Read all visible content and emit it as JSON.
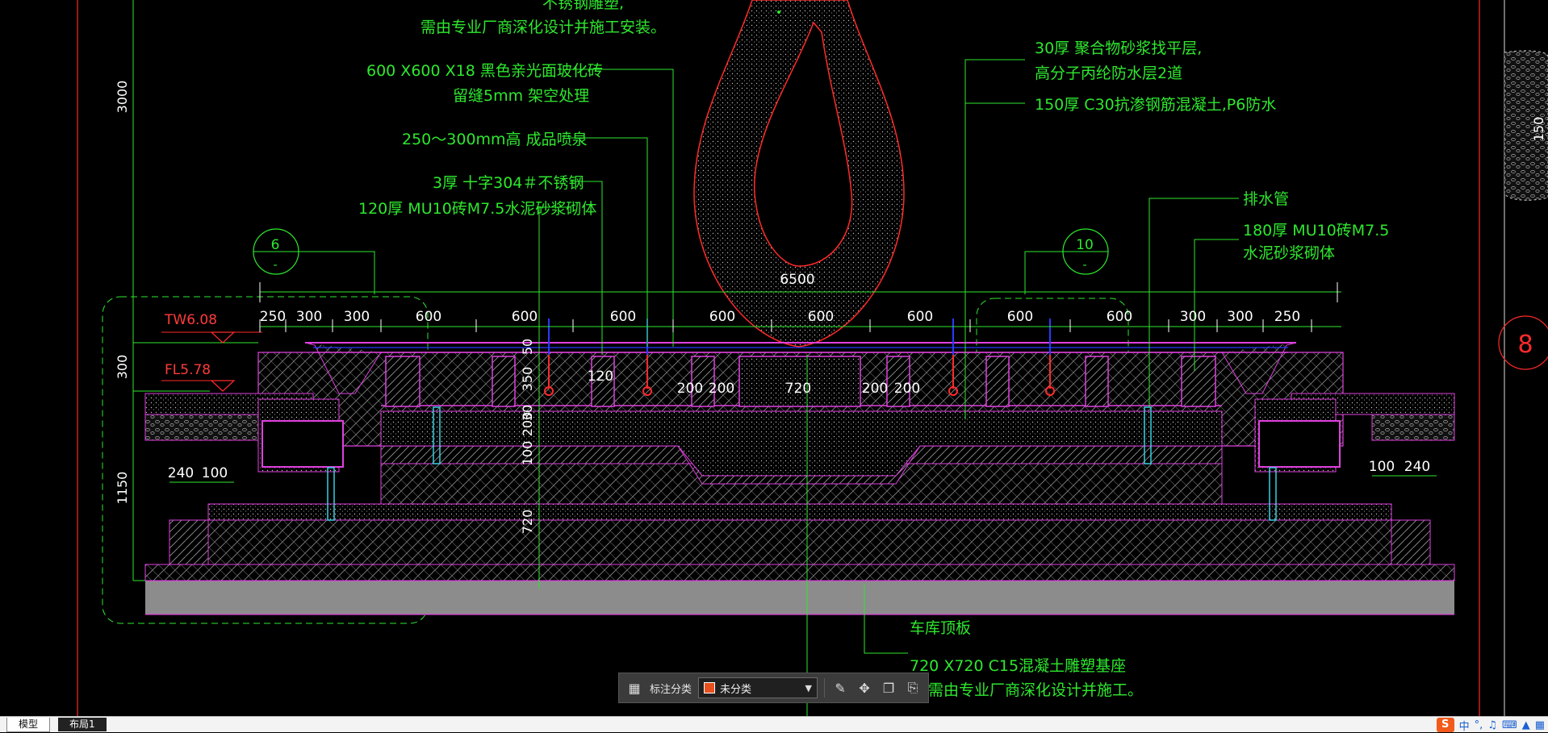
{
  "annotations": {
    "top_a": "不锈钢雕塑,",
    "top_b": "需由专业厂商深化设计并施工安装。",
    "tile_a": "600 X600 X18  黑色亲光面玻化砖",
    "tile_b": "留缝5mm  架空处理",
    "jets": "250～300mm高  成品喷泉",
    "steel": "3厚  十字304＃不锈钢",
    "brick": "120厚  MU10砖M7.5水泥砂浆砌体",
    "mortar_a": "30厚  聚合物砂浆找平层,",
    "mortar_b": "高分子丙纶防水层2道",
    "concrete": "150厚  C30抗渗钢筋混凝土,P6防水",
    "drain": "排水管",
    "brick180_a": "180厚  MU10砖M7.5",
    "brick180_b": "水泥砂浆砌体",
    "roof": "车库顶板",
    "base_a": "720 X720  C15混凝土雕塑基座",
    "base_b": "需由专业厂商深化设计并施工。"
  },
  "levels": {
    "tw": "TW6.08",
    "fl": "FL5.78"
  },
  "callouts": {
    "left_num": "6",
    "left_sub": "-",
    "right_num": "10",
    "right_sub": "-",
    "edge_num": "8"
  },
  "dims": {
    "overall": "6500",
    "top_row": [
      "250",
      "300",
      "300",
      "600",
      "600",
      "600",
      "600",
      "600",
      "600",
      "600",
      "600",
      "300",
      "300",
      "250"
    ],
    "left_vert": [
      "3000",
      "300",
      "1150"
    ],
    "inner_vert": [
      "50",
      "350",
      "30",
      "200",
      "100",
      "720"
    ],
    "inner_h": [
      "120",
      "200",
      "200",
      "720",
      "200",
      "200"
    ],
    "left_bottom": [
      "240",
      "100"
    ],
    "right_bottom": [
      "100",
      "240"
    ],
    "right_edge": "150"
  },
  "toolbar": {
    "grid_icon": "grid-icon",
    "label": "标注分类",
    "category": "未分类",
    "category_color": "#e8501e",
    "tools": [
      "edit-icon",
      "move-icon",
      "copy-icon",
      "paste-icon"
    ]
  },
  "tabs": {
    "model": "模型",
    "layout": "布局1"
  },
  "ime": {
    "logo": "S",
    "lang": "中"
  }
}
